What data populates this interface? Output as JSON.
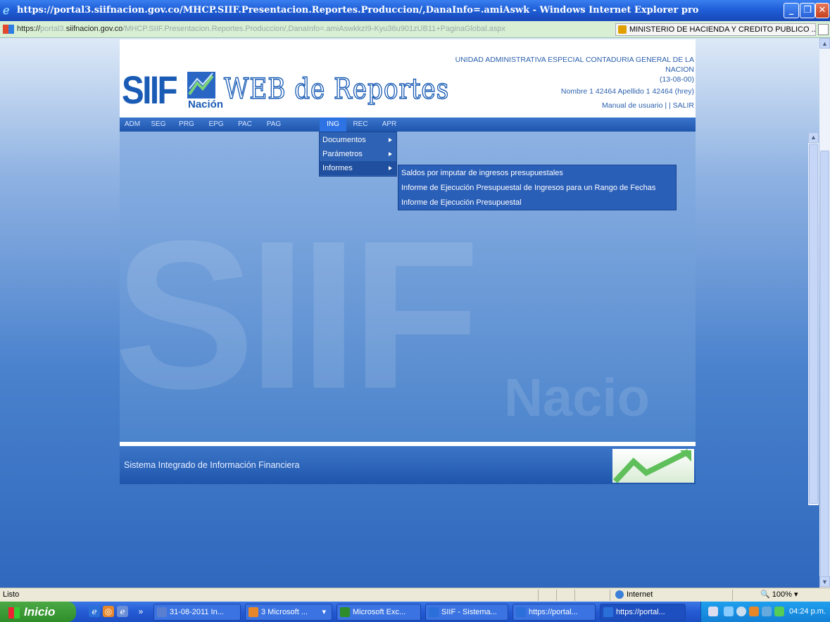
{
  "window": {
    "title": "https://portal3.siifnacion.gov.co/MHCP.SIIF.Presentacion.Reportes.Produccion/,DanaInfo=.amiAswk - Windows Internet Explorer pro"
  },
  "address": {
    "scheme": "https://",
    "host_prefix": "portal3.",
    "domain": "siifnacion.gov.co",
    "path": "/MHCP.SIIF.Presentacion.Reportes.Produccion/,DanaInfo=.amiAswkkzI9-Kyu36u901zUB11+PaginaGlobal.aspx",
    "certificate": "MINISTERIO DE HACIENDA Y CREDITO PUBLICO ..."
  },
  "header": {
    "logo_text": "SIIF",
    "logo_sub": "Nación",
    "app_title": "WEB de Reportes",
    "entity_line1": "UNIDAD ADMINISTRATIVA ESPECIAL CONTADURIA GENERAL DE LA",
    "entity_line2": "NACION",
    "entity_code": "(13-08-00)",
    "user": "Nombre 1 42464 Apellido 1 42464 (hrey)",
    "manual_link": "Manual de usuario",
    "separator": "| |",
    "exit_link": "SALIR"
  },
  "nav": {
    "items": [
      "ADM",
      "SEG",
      "PRG",
      "EPG",
      "PAC",
      "PAG",
      "ING",
      "REC",
      "APR"
    ],
    "active": "ING"
  },
  "menu": {
    "items": [
      "Documentos",
      "Parámetros",
      "Informes"
    ],
    "highlighted": "Informes"
  },
  "submenu": {
    "items": [
      "Saldos por imputar de ingresos presupuestales",
      "Informe de Ejecución Presupuestal de Ingresos para un Rango de Fechas",
      "Informe de Ejecución Presupuestal"
    ]
  },
  "footer": {
    "system_name": "Sistema Integrado de Información Financiera"
  },
  "watermark": {
    "big": "SIIF",
    "sub": "Nacio"
  },
  "statusbar": {
    "status": "Listo",
    "zone": "Internet",
    "zoom": "100%"
  },
  "taskbar": {
    "start": "Inicio",
    "overflow": "»",
    "tasks": [
      "31-08-2011 In...",
      "3 Microsoft ...",
      "Microsoft Exc...",
      "SIIF - Sistema...",
      "https://portal...",
      "https://portal..."
    ],
    "clock": "04:24 p.m."
  },
  "colors": {
    "accent": "#1a5cb5",
    "nav_active": "#2e73e4",
    "menu_bg": "#2e62b4"
  }
}
